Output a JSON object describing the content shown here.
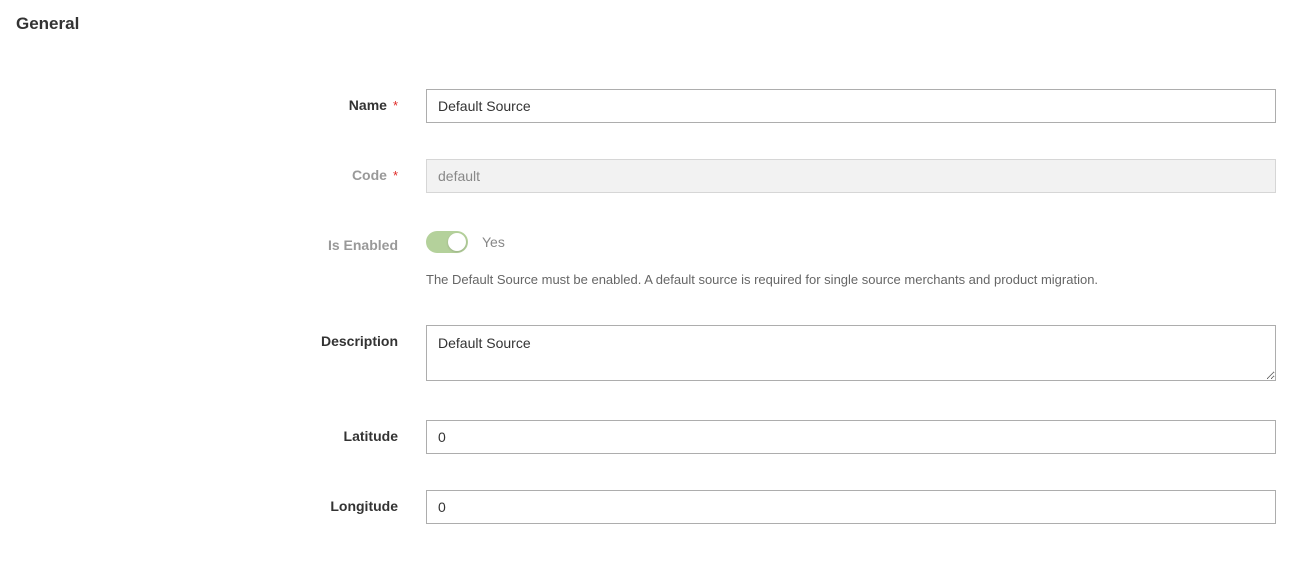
{
  "section": {
    "title": "General"
  },
  "fields": {
    "name": {
      "label": "Name",
      "value": "Default Source",
      "required": true
    },
    "code": {
      "label": "Code",
      "value": "default",
      "required": true
    },
    "is_enabled": {
      "label": "Is Enabled",
      "toggle_text": "Yes",
      "help": "The Default Source must be enabled. A default source is required for single source merchants and product migration."
    },
    "description": {
      "label": "Description",
      "value": "Default Source"
    },
    "latitude": {
      "label": "Latitude",
      "value": "0"
    },
    "longitude": {
      "label": "Longitude",
      "value": "0"
    }
  }
}
